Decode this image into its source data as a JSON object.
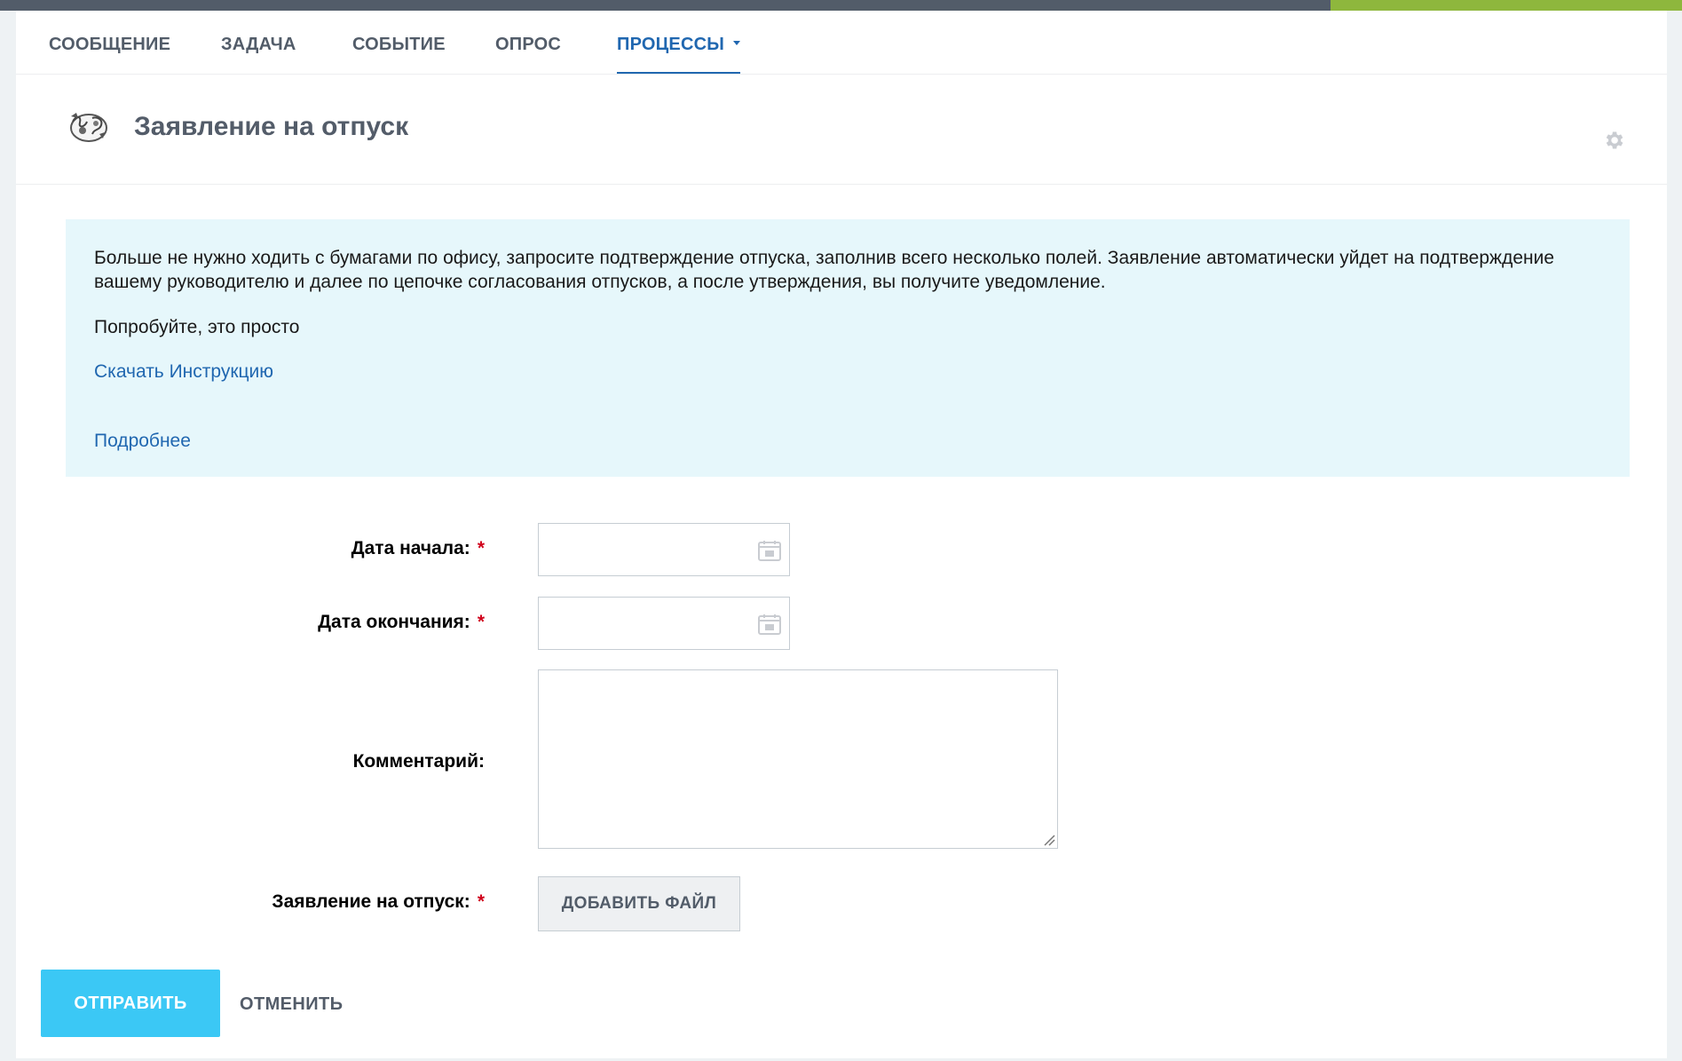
{
  "tabs": [
    {
      "label": "СООБЩЕНИЕ"
    },
    {
      "label": "ЗАДАЧА"
    },
    {
      "label": "СОБЫТИЕ"
    },
    {
      "label": "ОПРОС"
    },
    {
      "label": "ПРОЦЕССЫ",
      "active": true
    }
  ],
  "header": {
    "title": "Заявление на отпуск",
    "icon": "process-icon",
    "settings_icon": "gear-icon"
  },
  "info": {
    "description": "Больше не нужно ходить с бумагами по офису, запросите подтверждение отпуска, заполнив всего несколько полей. Заявление автоматически уйдет на подтверждение вашему руководителю и далее по цепочке согласования отпусков, а после утверждения, вы получите уведомление.",
    "try_text": "Попробуйте, это просто",
    "download_link": "Скачать Инструкцию",
    "more_link": "Подробнее"
  },
  "form": {
    "start_date": {
      "label": "Дата начала:",
      "required_mark": "*",
      "value": ""
    },
    "end_date": {
      "label": "Дата окончания:",
      "required_mark": "*",
      "value": ""
    },
    "comment": {
      "label": "Комментарий:",
      "value": ""
    },
    "attachment": {
      "label": "Заявление на отпуск:",
      "required_mark": "*",
      "button": "ДОБАВИТЬ ФАЙЛ"
    }
  },
  "actions": {
    "submit": "ОТПРАВИТЬ",
    "cancel": "ОТМЕНИТЬ"
  },
  "colors": {
    "accent": "#2067b0",
    "submit": "#3bc8f5",
    "info_bg": "#e6f7fb",
    "required": "#d0021b",
    "topbar": "#525c69",
    "topbar_accent": "#8eb73d"
  }
}
